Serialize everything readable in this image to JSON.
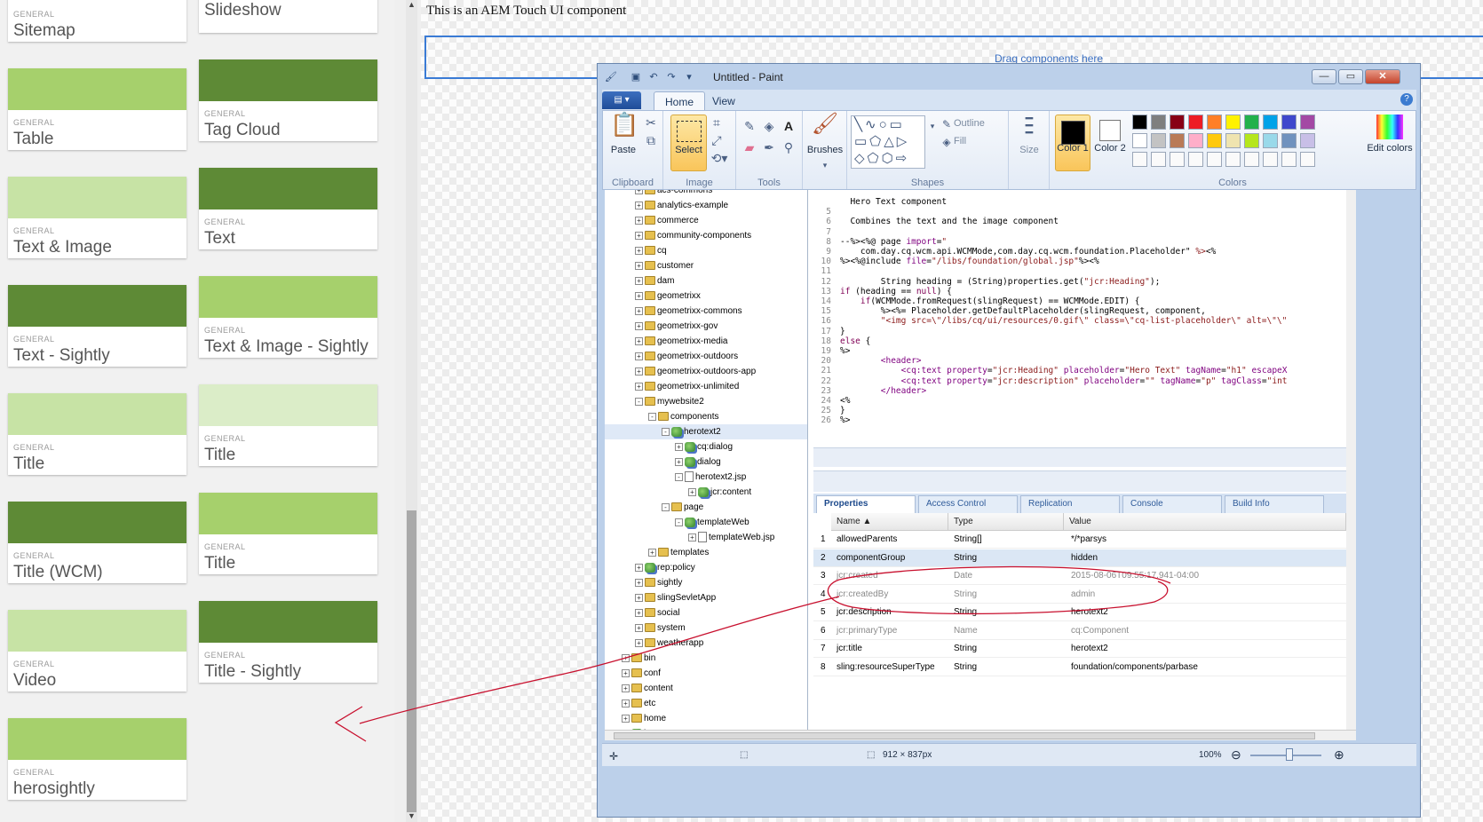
{
  "sidebar": {
    "cards": [
      {
        "group": "GENERAL",
        "title": "Sitemap",
        "swatch": "#ffffff"
      },
      {
        "group": "",
        "title": "Slideshow",
        "swatch": "#ffffff"
      },
      {
        "group": "GENERAL",
        "title": "Table",
        "swatch": "#a6d06c"
      },
      {
        "group": "GENERAL",
        "title": "Tag Cloud",
        "swatch": "#5e8a36"
      },
      {
        "group": "GENERAL",
        "title": "Text & Image",
        "swatch": "#c7e3a5"
      },
      {
        "group": "GENERAL",
        "title": "Text",
        "swatch": "#5e8a36"
      },
      {
        "group": "GENERAL",
        "title": "Text - Sightly",
        "swatch": "#5e8a36"
      },
      {
        "group": "GENERAL",
        "title": "Text & Image - Sightly",
        "swatch": "#a6d06c"
      },
      {
        "group": "GENERAL",
        "title": "Title",
        "swatch": "#c7e3a5"
      },
      {
        "group": "GENERAL",
        "title": "Title",
        "swatch": "#dbedc8"
      },
      {
        "group": "GENERAL",
        "title": "Title (WCM)",
        "swatch": "#5e8a36"
      },
      {
        "group": "GENERAL",
        "title": "Title",
        "swatch": "#a6d06c"
      },
      {
        "group": "GENERAL",
        "title": "Video",
        "swatch": "#c7e3a5"
      },
      {
        "group": "GENERAL",
        "title": "Title - Sightly",
        "swatch": "#5e8a36"
      },
      {
        "group": "GENERAL",
        "title": "herosightly",
        "swatch": "#a6d06c"
      }
    ]
  },
  "page": {
    "intro_text": "This is an AEM Touch UI component",
    "drop_zone": "Drag components here"
  },
  "paint": {
    "title": "Untitled - Paint",
    "tabs": [
      "Home",
      "View"
    ],
    "ribbon": {
      "paste": "Paste",
      "select": "Select",
      "brushes": "Brushes",
      "outline": "Outline",
      "fill": "Fill",
      "size": "Size",
      "color1": "Color 1",
      "color2": "Color 2",
      "edit_colors": "Edit colors",
      "groups": [
        "Clipboard",
        "Image",
        "Tools",
        "Shapes",
        "Colors"
      ],
      "palette": [
        "#000000",
        "#7f7f7f",
        "#880015",
        "#ed1c24",
        "#ff7f27",
        "#fff200",
        "#22b14c",
        "#00a2e8",
        "#3f48cc",
        "#a349a4",
        "#ffffff",
        "#c3c3c3",
        "#b97a57",
        "#ffaec9",
        "#ffc90e",
        "#efe4b0",
        "#b5e61d",
        "#99d9ea",
        "#7092be",
        "#c8bfe7"
      ]
    },
    "tree": [
      {
        "label": "acs-commons",
        "depth": 2,
        "icon": "folder",
        "exp": "+"
      },
      {
        "label": "analytics-example",
        "depth": 2,
        "icon": "folder",
        "exp": "+"
      },
      {
        "label": "commerce",
        "depth": 2,
        "icon": "folder",
        "exp": "+"
      },
      {
        "label": "community-components",
        "depth": 2,
        "icon": "folder",
        "exp": "+"
      },
      {
        "label": "cq",
        "depth": 2,
        "icon": "folder",
        "exp": "+"
      },
      {
        "label": "customer",
        "depth": 2,
        "icon": "folder",
        "exp": "+"
      },
      {
        "label": "dam",
        "depth": 2,
        "icon": "folder",
        "exp": "+"
      },
      {
        "label": "geometrixx",
        "depth": 2,
        "icon": "folder",
        "exp": "+"
      },
      {
        "label": "geometrixx-commons",
        "depth": 2,
        "icon": "folder",
        "exp": "+"
      },
      {
        "label": "geometrixx-gov",
        "depth": 2,
        "icon": "folder",
        "exp": "+"
      },
      {
        "label": "geometrixx-media",
        "depth": 2,
        "icon": "folder",
        "exp": "+"
      },
      {
        "label": "geometrixx-outdoors",
        "depth": 2,
        "icon": "folder",
        "exp": "+"
      },
      {
        "label": "geometrixx-outdoors-app",
        "depth": 2,
        "icon": "folder",
        "exp": "+"
      },
      {
        "label": "geometrixx-unlimited",
        "depth": 2,
        "icon": "folder",
        "exp": "+"
      },
      {
        "label": "mywebsite2",
        "depth": 2,
        "icon": "folder",
        "exp": "-"
      },
      {
        "label": "components",
        "depth": 3,
        "icon": "folder",
        "exp": "-"
      },
      {
        "label": "herotext2",
        "depth": 4,
        "icon": "node",
        "exp": "-",
        "selected": true
      },
      {
        "label": "cq:dialog",
        "depth": 5,
        "icon": "node",
        "exp": "+"
      },
      {
        "label": "dialog",
        "depth": 5,
        "icon": "node",
        "exp": "+"
      },
      {
        "label": "herotext2.jsp",
        "depth": 5,
        "icon": "file",
        "exp": "-"
      },
      {
        "label": "jcr:content",
        "depth": 6,
        "icon": "node",
        "exp": "+"
      },
      {
        "label": "page",
        "depth": 4,
        "icon": "folder",
        "exp": "-"
      },
      {
        "label": "templateWeb",
        "depth": 5,
        "icon": "node",
        "exp": "-"
      },
      {
        "label": "templateWeb.jsp",
        "depth": 6,
        "icon": "file",
        "exp": "+"
      },
      {
        "label": "templates",
        "depth": 3,
        "icon": "folder",
        "exp": "+"
      },
      {
        "label": "rep:policy",
        "depth": 2,
        "icon": "node",
        "exp": "+"
      },
      {
        "label": "sightly",
        "depth": 2,
        "icon": "folder",
        "exp": "+"
      },
      {
        "label": "slingSevletApp",
        "depth": 2,
        "icon": "folder",
        "exp": "+"
      },
      {
        "label": "social",
        "depth": 2,
        "icon": "folder",
        "exp": "+"
      },
      {
        "label": "system",
        "depth": 2,
        "icon": "folder",
        "exp": "+"
      },
      {
        "label": "weatherapp",
        "depth": 2,
        "icon": "folder",
        "exp": "+"
      },
      {
        "label": "bin",
        "depth": 1,
        "icon": "folder",
        "exp": "+"
      },
      {
        "label": "conf",
        "depth": 1,
        "icon": "folder",
        "exp": "+"
      },
      {
        "label": "content",
        "depth": 1,
        "icon": "folder",
        "exp": "+"
      },
      {
        "label": "etc",
        "depth": 1,
        "icon": "folder",
        "exp": "+"
      },
      {
        "label": "home",
        "depth": 1,
        "icon": "folder",
        "exp": "+"
      },
      {
        "label": "jcr:system",
        "depth": 1,
        "icon": "node",
        "exp": "+"
      }
    ],
    "code_lines": [
      {
        "n": "",
        "html": "  Hero Text component"
      },
      {
        "n": "5",
        "html": ""
      },
      {
        "n": "6",
        "html": "  Combines the text and the image component"
      },
      {
        "n": "7",
        "html": ""
      },
      {
        "n": "8",
        "html": "--%><%@ page <span class=\"at\">import</span>=<span class=\"st\">\"</span>"
      },
      {
        "n": "9",
        "html": "    com.day.cq.wcm.api.WCMMode,com.day.cq.wcm.foundation.Placeholder\" <span class=\"st\">%></span>&lt;%"
      },
      {
        "n": "10",
        "html": "%><%@include <span class=\"at\">file</span>=<span class=\"st\">\"/libs/foundation/global.jsp\"</span>%>&lt;%"
      },
      {
        "n": "11",
        "html": ""
      },
      {
        "n": "12",
        "html": "        String heading = (String)properties.get(<span class=\"st\">\"jcr:Heading\"</span>);"
      },
      {
        "n": "13",
        "html": "<span class=\"kw\">if</span> (heading == <span class=\"kw\">null</span>) {"
      },
      {
        "n": "14",
        "html": "    <span class=\"kw\">if</span>(WCMMode.fromRequest(slingRequest) == WCMMode.EDIT) {"
      },
      {
        "n": "15",
        "html": "        %>&lt;%= Placeholder.getDefaultPlaceholder(slingRequest, component,"
      },
      {
        "n": "16",
        "html": "        <span class=\"st\">\"&lt;img src=\\\"/libs/cq/ui/resources/0.gif\\\" class=\\\"cq-list-placeholder\\\" alt=\\\"\\\"</span>"
      },
      {
        "n": "17",
        "html": "}"
      },
      {
        "n": "18",
        "html": "<span class=\"kw\">else</span> {"
      },
      {
        "n": "19",
        "html": "%>"
      },
      {
        "n": "20",
        "html": "        <span class=\"at\">&lt;header&gt;</span>"
      },
      {
        "n": "21",
        "html": "            <span class=\"at\">&lt;cq:text</span> <span class=\"at\">property</span>=<span class=\"st\">\"jcr:Heading\"</span> <span class=\"at\">placeholder</span>=<span class=\"st\">\"Hero Text\"</span> <span class=\"at\">tagName</span>=<span class=\"st\">\"h1\"</span> <span class=\"at\">escapeX</span>"
      },
      {
        "n": "22",
        "html": "            <span class=\"at\">&lt;cq:text</span> <span class=\"at\">property</span>=<span class=\"st\">\"jcr:description\"</span> <span class=\"at\">placeholder</span>=<span class=\"st\">\"\"</span> <span class=\"at\">tagName</span>=<span class=\"st\">\"p\"</span> <span class=\"at\">tagClass</span>=<span class=\"st\">\"int</span>"
      },
      {
        "n": "23",
        "html": "        <span class=\"at\">&lt;/header&gt;</span>"
      },
      {
        "n": "24",
        "html": "&lt;%"
      },
      {
        "n": "25",
        "html": "}"
      },
      {
        "n": "26",
        "html": "%>"
      }
    ],
    "prop_tabs": [
      "Properties",
      "Access Control",
      "Replication",
      "Console",
      "Build Info"
    ],
    "prop_headers": {
      "name": "Name ▲",
      "type": "Type",
      "value": "Value"
    },
    "props": [
      {
        "idx": "1",
        "name": "allowedParents",
        "type": "String[]",
        "value": "*/*parsys"
      },
      {
        "idx": "2",
        "name": "componentGroup",
        "type": "String",
        "value": "hidden",
        "selected": true
      },
      {
        "idx": "3",
        "name": "jcr:created",
        "type": "Date",
        "value": "2015-08-06T09:55:17.941-04:00",
        "dim": true
      },
      {
        "idx": "4",
        "name": "jcr:createdBy",
        "type": "String",
        "value": "admin",
        "dim": true
      },
      {
        "idx": "5",
        "name": "jcr:description",
        "type": "String",
        "value": "herotext2"
      },
      {
        "idx": "6",
        "name": "jcr:primaryType",
        "type": "Name",
        "value": "cq:Component",
        "dim": true
      },
      {
        "idx": "7",
        "name": "jcr:title",
        "type": "String",
        "value": "herotext2"
      },
      {
        "idx": "8",
        "name": "sling:resourceSuperType",
        "type": "String",
        "value": "foundation/components/parbase"
      }
    ],
    "status": {
      "dimensions": "912 × 837px",
      "zoom": "100%"
    }
  }
}
